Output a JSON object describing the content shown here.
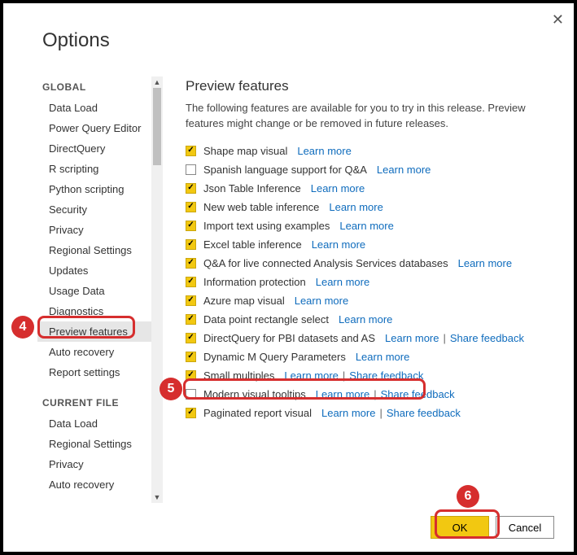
{
  "title": "Options",
  "sidebar": {
    "global_label": "GLOBAL",
    "global": [
      "Data Load",
      "Power Query Editor",
      "DirectQuery",
      "R scripting",
      "Python scripting",
      "Security",
      "Privacy",
      "Regional Settings",
      "Updates",
      "Usage Data",
      "Diagnostics",
      "Preview features",
      "Auto recovery",
      "Report settings"
    ],
    "current_label": "CURRENT FILE",
    "current": [
      "Data Load",
      "Regional Settings",
      "Privacy",
      "Auto recovery"
    ]
  },
  "main": {
    "title": "Preview features",
    "description": "The following features are available for you to try in this release. Preview features might change or be removed in future releases.",
    "learn_more": "Learn more",
    "share_feedback": "Share feedback",
    "features": [
      {
        "label": "Shape map visual",
        "checked": true,
        "lm": true,
        "sf": false
      },
      {
        "label": "Spanish language support for Q&A",
        "checked": false,
        "lm": true,
        "sf": false
      },
      {
        "label": "Json Table Inference",
        "checked": true,
        "lm": true,
        "sf": false
      },
      {
        "label": "New web table inference",
        "checked": true,
        "lm": true,
        "sf": false
      },
      {
        "label": "Import text using examples",
        "checked": true,
        "lm": true,
        "sf": false
      },
      {
        "label": "Excel table inference",
        "checked": true,
        "lm": true,
        "sf": false
      },
      {
        "label": "Q&A for live connected Analysis Services databases",
        "checked": true,
        "lm": true,
        "sf": false
      },
      {
        "label": "Information protection",
        "checked": true,
        "lm": true,
        "sf": false
      },
      {
        "label": "Azure map visual",
        "checked": true,
        "lm": true,
        "sf": false
      },
      {
        "label": "Data point rectangle select",
        "checked": true,
        "lm": true,
        "sf": false
      },
      {
        "label": "DirectQuery for PBI datasets and AS",
        "checked": true,
        "lm": true,
        "sf": true
      },
      {
        "label": "Dynamic M Query Parameters",
        "checked": true,
        "lm": true,
        "sf": false
      },
      {
        "label": "Small multiples",
        "checked": true,
        "lm": true,
        "sf": true
      },
      {
        "label": "Modern visual tooltips",
        "checked": false,
        "lm": true,
        "sf": true
      },
      {
        "label": "Paginated report visual",
        "checked": true,
        "lm": true,
        "sf": true
      }
    ]
  },
  "buttons": {
    "ok": "OK",
    "cancel": "Cancel"
  },
  "callouts": [
    "4",
    "5",
    "6"
  ]
}
